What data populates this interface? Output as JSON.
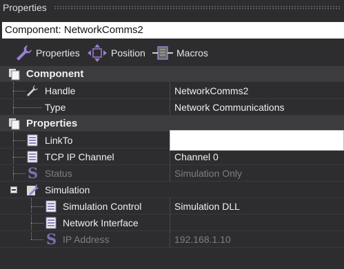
{
  "panel": {
    "title": "Properties"
  },
  "component_field": {
    "value": "Component: NetworkComms2"
  },
  "tabs": [
    {
      "label": "Properties",
      "icon": "wrench-icon"
    },
    {
      "label": "Position",
      "icon": "move-icon"
    },
    {
      "label": "Macros",
      "icon": "macro-icon"
    }
  ],
  "grid": {
    "component": {
      "label": "Component",
      "handle": {
        "name": "Handle",
        "value": "NetworkComms2"
      },
      "type": {
        "name": "Type",
        "value": "Network Communications"
      }
    },
    "properties": {
      "label": "Properties",
      "linkto": {
        "name": "LinkTo",
        "value": ""
      },
      "tcp": {
        "name": "TCP IP Channel",
        "value": "Channel 0"
      },
      "status": {
        "name": "Status",
        "value": "Simulation Only"
      },
      "simulation": {
        "name": "Simulation",
        "control": {
          "name": "Simulation Control",
          "value": "Simulation DLL"
        },
        "netif": {
          "name": "Network Interface",
          "value": ""
        },
        "ip": {
          "name": "IP Address",
          "value": "192.168.1.10"
        }
      }
    }
  },
  "colors": {
    "background": "#2d2d30",
    "category": "#3c3c3f",
    "accent_purple": "#9b7fd4",
    "dim_text": "#7f7f7f"
  }
}
